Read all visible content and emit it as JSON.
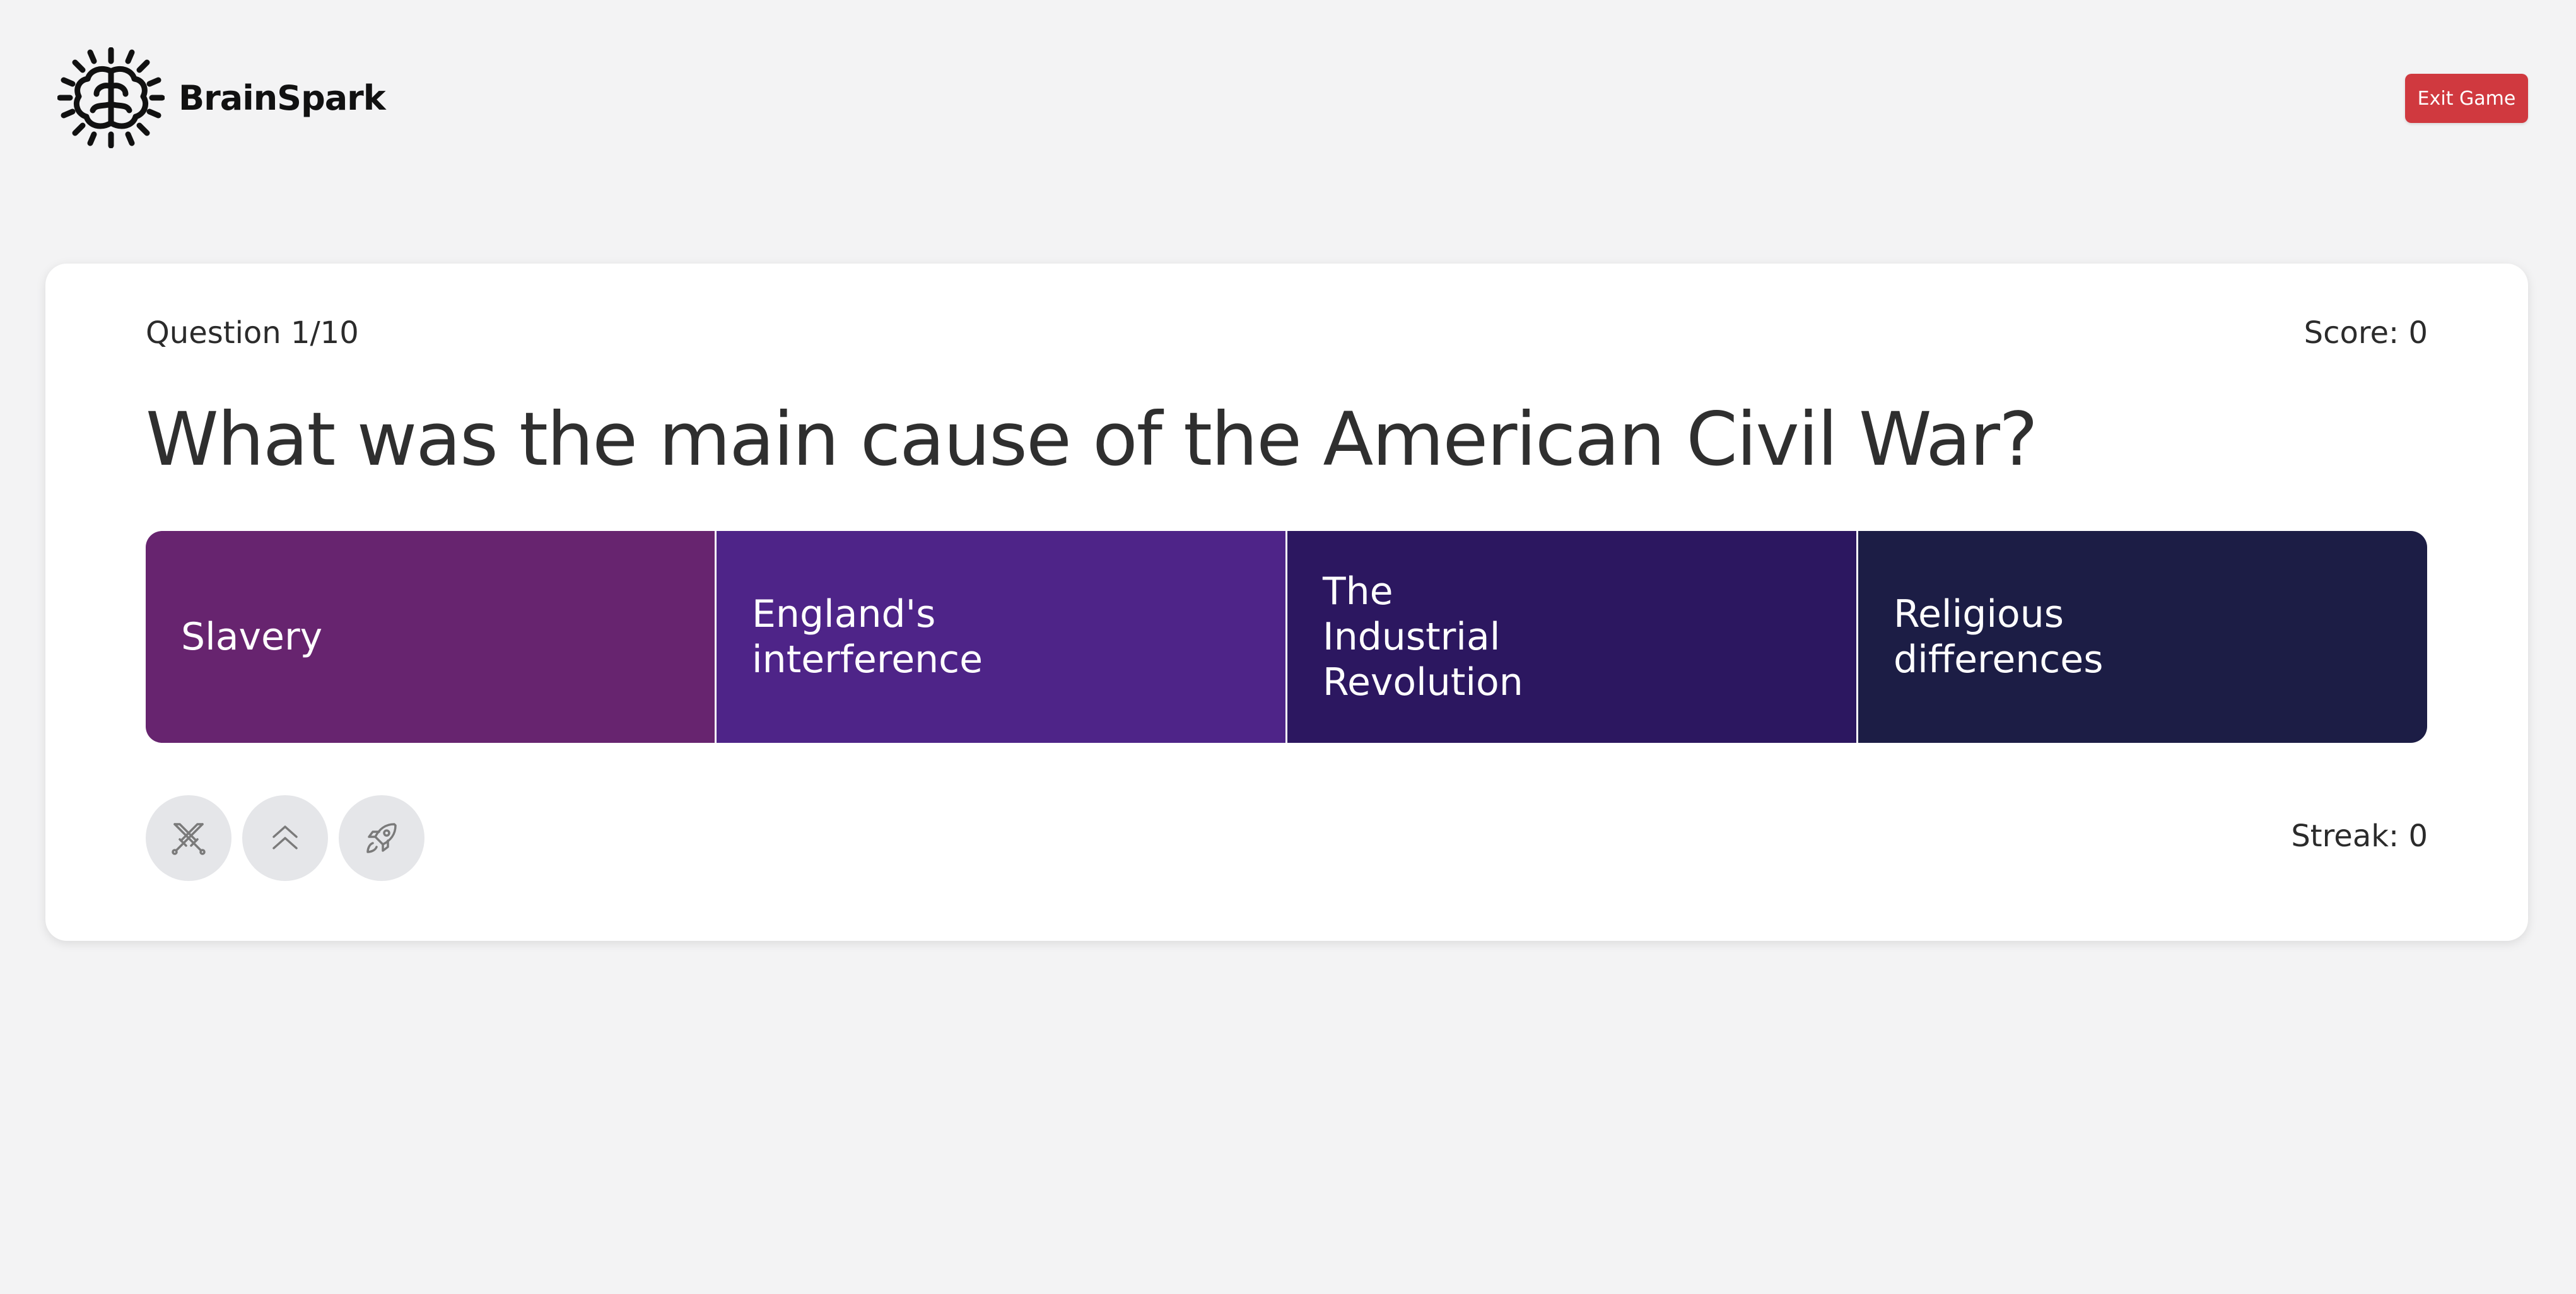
{
  "app": {
    "name": "BrainSpark",
    "logo_icon": "brain-spark-icon"
  },
  "header": {
    "exit_label": "Exit Game",
    "exit_color": "#d0393f"
  },
  "quiz": {
    "question_counter": "Question 1/10",
    "score": "Score: 0",
    "question": "What was the main cause of the American Civil War?",
    "answers": [
      {
        "label": "Slavery",
        "color": "#67246f"
      },
      {
        "label": "England's interference",
        "color": "#4e2488"
      },
      {
        "label": "The Industrial Revolution",
        "color": "#2c1760"
      },
      {
        "label": "Religious differences",
        "color": "#1c1d45"
      }
    ],
    "powerups": [
      {
        "icon": "crossed-swords-icon"
      },
      {
        "icon": "double-chevron-up-icon"
      },
      {
        "icon": "rocket-icon"
      }
    ],
    "streak": "Streak: 0"
  }
}
